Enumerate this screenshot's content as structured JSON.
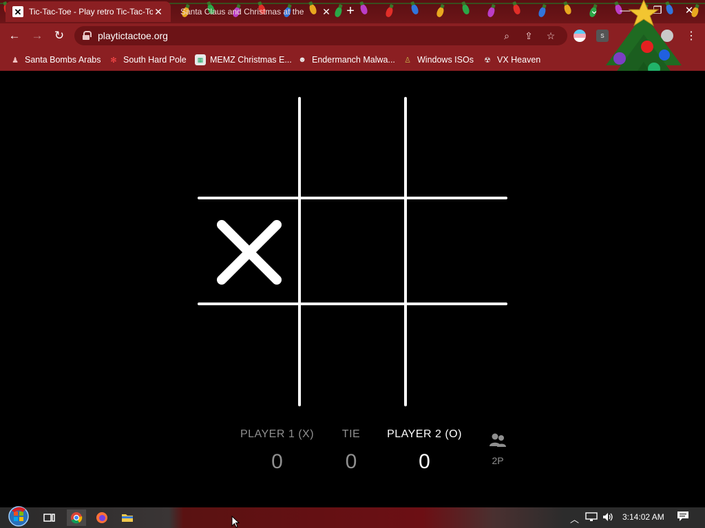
{
  "browser": {
    "tabs": [
      {
        "title": "Tic-Tac-Toe - Play retro Tic-Tac-To",
        "active": true,
        "favicon": "x-favicon"
      },
      {
        "title": "Santa Claus and Christmas at the",
        "active": false,
        "favicon": "none"
      }
    ],
    "new_tab_label": "+",
    "url": "playtictactoe.org",
    "window_controls": [
      "chevron-down-icon",
      "minimize-icon",
      "restore-icon",
      "close-icon"
    ],
    "bookmarks": [
      {
        "label": "Santa Bombs Arabs",
        "icon": "santa-icon"
      },
      {
        "label": "South Hard Pole",
        "icon": "snowflake-icon"
      },
      {
        "label": "MEMZ Christmas E...",
        "icon": "memz-icon"
      },
      {
        "label": "Endermanch Malwa...",
        "icon": "skull-icon"
      },
      {
        "label": "Windows ISOs",
        "icon": "windows-iso-icon"
      },
      {
        "label": "VX Heaven",
        "icon": "vx-heaven-icon"
      }
    ],
    "theme_colors": {
      "frame": "#5a0f12",
      "toolbar": "#8b1f22",
      "omnibox": "#6c1316"
    }
  },
  "game": {
    "board": [
      "",
      "",
      "",
      "X",
      "",
      "",
      "",
      "",
      ""
    ],
    "scoreboard": {
      "player1_label": "PLAYER 1 (X)",
      "player1_score": "0",
      "tie_label": "TIE",
      "tie_score": "0",
      "player2_label": "PLAYER 2 (O)",
      "player2_score": "0",
      "active_player": "player2",
      "mode_label": "2P",
      "mode_icon": "two-players-icon"
    }
  },
  "taskbar": {
    "items": [
      "start-orb-icon",
      "task-view-icon",
      "chrome-icon",
      "firefox-icon",
      "file-explorer-icon"
    ],
    "tray_icons": [
      "chevron-up-icon",
      "network-icon",
      "volume-icon"
    ],
    "clock": "3:14:02 AM",
    "notification_icon": "action-center-icon"
  }
}
